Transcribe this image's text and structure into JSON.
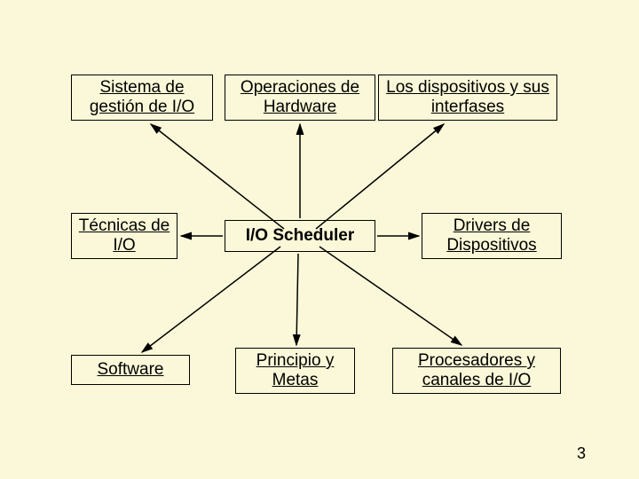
{
  "boxes": {
    "top_left": "Sistema de gestión de I/O",
    "top_mid": "Operaciones de Hardware",
    "top_right": "Los dispositivos y sus interfases",
    "mid_left": " Técnicas de I/O",
    "center": "I/O Scheduler",
    "mid_right": " Drivers de Dispositivos",
    "bot_left": " Software",
    "bot_mid": "Principio y Metas",
    "bot_right": " Procesadores y canales de I/O"
  },
  "page_number": "3"
}
